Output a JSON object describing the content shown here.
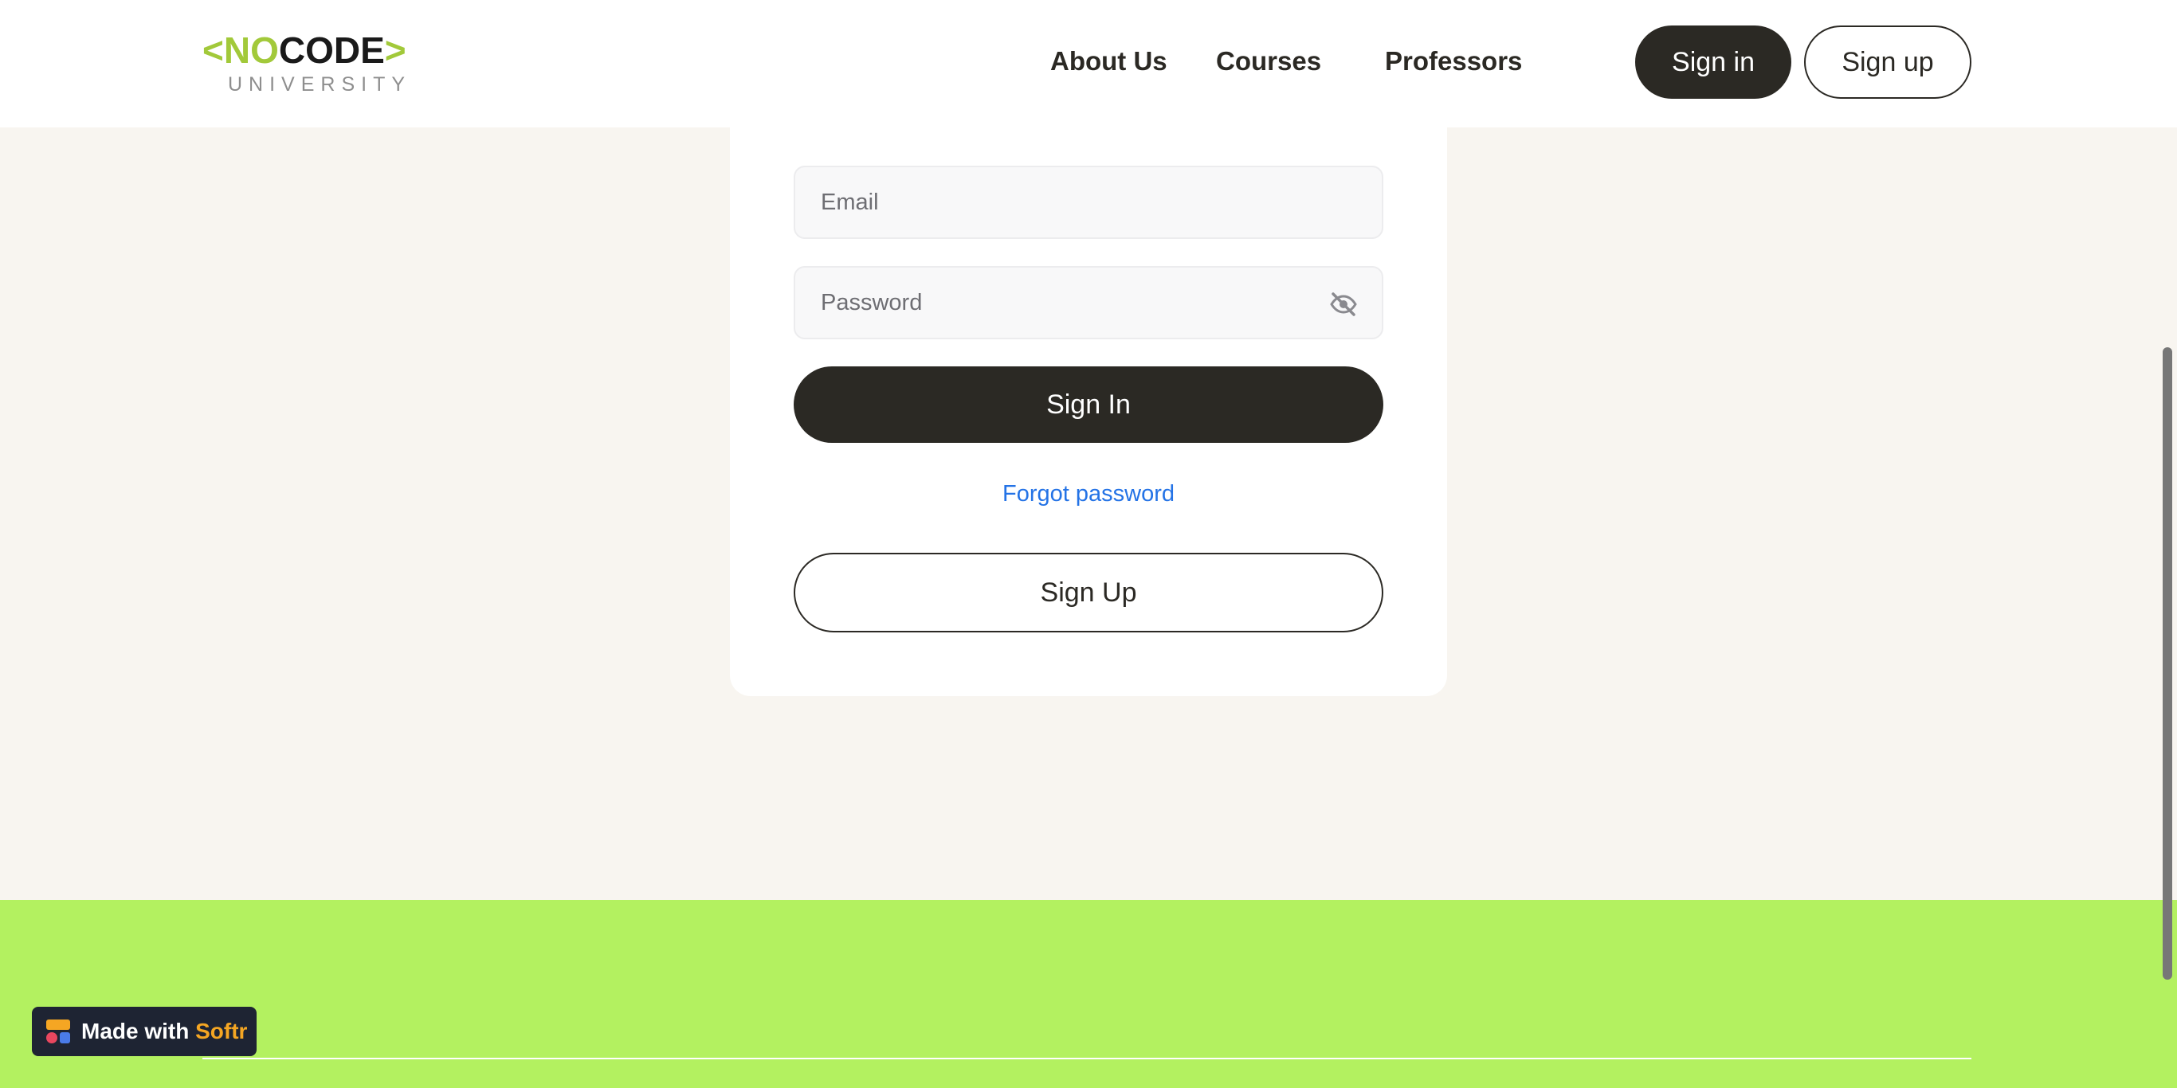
{
  "header": {
    "logo": {
      "bracket_open": "<",
      "word_accent": "NO",
      "word_dark": "CODE",
      "bracket_close": ">",
      "subtitle": "UNIVERSITY"
    },
    "nav": [
      {
        "label": "About Us"
      },
      {
        "label": "Courses"
      },
      {
        "label": "Professors"
      }
    ],
    "signin_label": "Sign in",
    "signup_label": "Sign up"
  },
  "form": {
    "email_placeholder": "Email",
    "email_value": "",
    "password_placeholder": "Password",
    "password_value": "",
    "password_toggle_icon": "eye-off-icon",
    "signin_button": "Sign In",
    "forgot_link": "Forgot password",
    "signup_button": "Sign Up"
  },
  "badge": {
    "prefix": "Made with ",
    "brand": "Softr",
    "icon": "softr-logo-icon"
  },
  "colors": {
    "page_background": "#f8f5f0",
    "footer_background": "#b3f160",
    "primary_dark": "#2b2924",
    "link_blue": "#2473e6",
    "logo_green": "#a2c93a",
    "badge_background": "#1e2433",
    "badge_brand": "#f5a623"
  }
}
